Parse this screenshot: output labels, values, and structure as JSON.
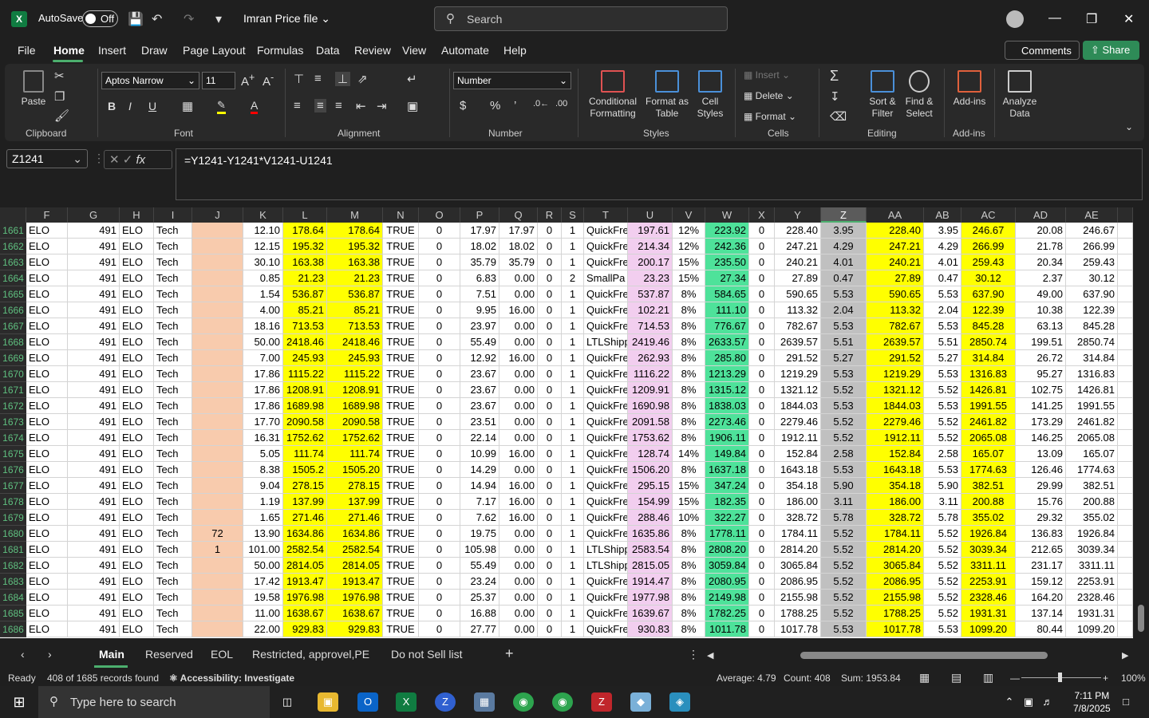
{
  "titlebar": {
    "autosave": "AutoSave",
    "toggle": "Off",
    "filename": "Imran Price file",
    "search_placeholder": "Search"
  },
  "menu": [
    "File",
    "Home",
    "Insert",
    "Draw",
    "Page Layout",
    "Formulas",
    "Data",
    "Review",
    "View",
    "Automate",
    "Help"
  ],
  "buttons": {
    "comments": "Comments",
    "share": "Share"
  },
  "ribbon": {
    "paste": "Paste",
    "clipboard": "Clipboard",
    "font_name": "Aptos Narrow",
    "font_size": "11",
    "font": "Font",
    "alignment": "Alignment",
    "number_format": "Number",
    "number": "Number",
    "conditional": "Conditional Formatting",
    "format_table": "Format as Table",
    "cell_styles": "Cell Styles",
    "styles": "Styles",
    "insert": "Insert",
    "delete": "Delete",
    "format": "Format",
    "cells": "Cells",
    "sort": "Sort & Filter",
    "find": "Find & Select",
    "editing": "Editing",
    "addins": "Add-ins",
    "addins_group": "Add-ins",
    "analyze": "Analyze Data"
  },
  "namebox": "Z1241",
  "formula": "=Y1241-Y1241*V1241-U1241",
  "columns": [
    "F",
    "G",
    "H",
    "I",
    "J",
    "K",
    "L",
    "M",
    "N",
    "O",
    "P",
    "Q",
    "R",
    "S",
    "T",
    "U",
    "V",
    "W",
    "X",
    "Y",
    "Z",
    "AA",
    "AB",
    "AC",
    "AD",
    "AE"
  ],
  "rows": [
    [
      "1661",
      "ELO",
      "491",
      "ELO",
      "Tech",
      "",
      "12.10",
      "178.64",
      "178.64",
      "TRUE",
      "0",
      "17.97",
      "17.97",
      "0",
      "1",
      "QuickFre",
      "197.61",
      "12%",
      "223.92",
      "0",
      "228.40",
      "3.95",
      "228.40",
      "3.95",
      "246.67",
      "20.08",
      "246.67"
    ],
    [
      "1662",
      "ELO",
      "491",
      "ELO",
      "Tech",
      "",
      "12.15",
      "195.32",
      "195.32",
      "TRUE",
      "0",
      "18.02",
      "18.02",
      "0",
      "1",
      "QuickFre",
      "214.34",
      "12%",
      "242.36",
      "0",
      "247.21",
      "4.29",
      "247.21",
      "4.29",
      "266.99",
      "21.78",
      "266.99"
    ],
    [
      "1663",
      "ELO",
      "491",
      "ELO",
      "Tech",
      "",
      "30.10",
      "163.38",
      "163.38",
      "TRUE",
      "0",
      "35.79",
      "35.79",
      "0",
      "1",
      "QuickFre",
      "200.17",
      "15%",
      "235.50",
      "0",
      "240.21",
      "4.01",
      "240.21",
      "4.01",
      "259.43",
      "20.34",
      "259.43"
    ],
    [
      "1664",
      "ELO",
      "491",
      "ELO",
      "Tech",
      "",
      "0.85",
      "21.23",
      "21.23",
      "TRUE",
      "0",
      "6.83",
      "0.00",
      "0",
      "2",
      "SmallPa",
      "23.23",
      "15%",
      "27.34",
      "0",
      "27.89",
      "0.47",
      "27.89",
      "0.47",
      "30.12",
      "2.37",
      "30.12"
    ],
    [
      "1665",
      "ELO",
      "491",
      "ELO",
      "Tech",
      "",
      "1.54",
      "536.87",
      "536.87",
      "TRUE",
      "0",
      "7.51",
      "0.00",
      "0",
      "1",
      "QuickFre",
      "537.87",
      "8%",
      "584.65",
      "0",
      "590.65",
      "5.53",
      "590.65",
      "5.53",
      "637.90",
      "49.00",
      "637.90"
    ],
    [
      "1666",
      "ELO",
      "491",
      "ELO",
      "Tech",
      "",
      "4.00",
      "85.21",
      "85.21",
      "TRUE",
      "0",
      "9.95",
      "16.00",
      "0",
      "1",
      "QuickFre",
      "102.21",
      "8%",
      "111.10",
      "0",
      "113.32",
      "2.04",
      "113.32",
      "2.04",
      "122.39",
      "10.38",
      "122.39"
    ],
    [
      "1667",
      "ELO",
      "491",
      "ELO",
      "Tech",
      "",
      "18.16",
      "713.53",
      "713.53",
      "TRUE",
      "0",
      "23.97",
      "0.00",
      "0",
      "1",
      "QuickFre",
      "714.53",
      "8%",
      "776.67",
      "0",
      "782.67",
      "5.53",
      "782.67",
      "5.53",
      "845.28",
      "63.13",
      "845.28"
    ],
    [
      "1668",
      "ELO",
      "491",
      "ELO",
      "Tech",
      "",
      "50.00",
      "2418.46",
      "2418.46",
      "TRUE",
      "0",
      "55.49",
      "0.00",
      "0",
      "1",
      "LTLShipp",
      "2419.46",
      "8%",
      "2633.57",
      "0",
      "2639.57",
      "5.51",
      "2639.57",
      "5.51",
      "2850.74",
      "199.51",
      "2850.74"
    ],
    [
      "1669",
      "ELO",
      "491",
      "ELO",
      "Tech",
      "",
      "7.00",
      "245.93",
      "245.93",
      "TRUE",
      "0",
      "12.92",
      "16.00",
      "0",
      "1",
      "QuickFre",
      "262.93",
      "8%",
      "285.80",
      "0",
      "291.52",
      "5.27",
      "291.52",
      "5.27",
      "314.84",
      "26.72",
      "314.84"
    ],
    [
      "1670",
      "ELO",
      "491",
      "ELO",
      "Tech",
      "",
      "17.86",
      "1115.22",
      "1115.22",
      "TRUE",
      "0",
      "23.67",
      "0.00",
      "0",
      "1",
      "QuickFre",
      "1116.22",
      "8%",
      "1213.29",
      "0",
      "1219.29",
      "5.53",
      "1219.29",
      "5.53",
      "1316.83",
      "95.27",
      "1316.83"
    ],
    [
      "1671",
      "ELO",
      "491",
      "ELO",
      "Tech",
      "",
      "17.86",
      "1208.91",
      "1208.91",
      "TRUE",
      "0",
      "23.67",
      "0.00",
      "0",
      "1",
      "QuickFre",
      "1209.91",
      "8%",
      "1315.12",
      "0",
      "1321.12",
      "5.52",
      "1321.12",
      "5.52",
      "1426.81",
      "102.75",
      "1426.81"
    ],
    [
      "1672",
      "ELO",
      "491",
      "ELO",
      "Tech",
      "",
      "17.86",
      "1689.98",
      "1689.98",
      "TRUE",
      "0",
      "23.67",
      "0.00",
      "0",
      "1",
      "QuickFre",
      "1690.98",
      "8%",
      "1838.03",
      "0",
      "1844.03",
      "5.53",
      "1844.03",
      "5.53",
      "1991.55",
      "141.25",
      "1991.55"
    ],
    [
      "1673",
      "ELO",
      "491",
      "ELO",
      "Tech",
      "",
      "17.70",
      "2090.58",
      "2090.58",
      "TRUE",
      "0",
      "23.51",
      "0.00",
      "0",
      "1",
      "QuickFre",
      "2091.58",
      "8%",
      "2273.46",
      "0",
      "2279.46",
      "5.52",
      "2279.46",
      "5.52",
      "2461.82",
      "173.29",
      "2461.82"
    ],
    [
      "1674",
      "ELO",
      "491",
      "ELO",
      "Tech",
      "",
      "16.31",
      "1752.62",
      "1752.62",
      "TRUE",
      "0",
      "22.14",
      "0.00",
      "0",
      "1",
      "QuickFre",
      "1753.62",
      "8%",
      "1906.11",
      "0",
      "1912.11",
      "5.52",
      "1912.11",
      "5.52",
      "2065.08",
      "146.25",
      "2065.08"
    ],
    [
      "1675",
      "ELO",
      "491",
      "ELO",
      "Tech",
      "",
      "5.05",
      "111.74",
      "111.74",
      "TRUE",
      "0",
      "10.99",
      "16.00",
      "0",
      "1",
      "QuickFre",
      "128.74",
      "14%",
      "149.84",
      "0",
      "152.84",
      "2.58",
      "152.84",
      "2.58",
      "165.07",
      "13.09",
      "165.07"
    ],
    [
      "1676",
      "ELO",
      "491",
      "ELO",
      "Tech",
      "",
      "8.38",
      "1505.2",
      "1505.20",
      "TRUE",
      "0",
      "14.29",
      "0.00",
      "0",
      "1",
      "QuickFre",
      "1506.20",
      "8%",
      "1637.18",
      "0",
      "1643.18",
      "5.53",
      "1643.18",
      "5.53",
      "1774.63",
      "126.46",
      "1774.63"
    ],
    [
      "1677",
      "ELO",
      "491",
      "ELO",
      "Tech",
      "",
      "9.04",
      "278.15",
      "278.15",
      "TRUE",
      "0",
      "14.94",
      "16.00",
      "0",
      "1",
      "QuickFre",
      "295.15",
      "15%",
      "347.24",
      "0",
      "354.18",
      "5.90",
      "354.18",
      "5.90",
      "382.51",
      "29.99",
      "382.51"
    ],
    [
      "1678",
      "ELO",
      "491",
      "ELO",
      "Tech",
      "",
      "1.19",
      "137.99",
      "137.99",
      "TRUE",
      "0",
      "7.17",
      "16.00",
      "0",
      "1",
      "QuickFre",
      "154.99",
      "15%",
      "182.35",
      "0",
      "186.00",
      "3.11",
      "186.00",
      "3.11",
      "200.88",
      "15.76",
      "200.88"
    ],
    [
      "1679",
      "ELO",
      "491",
      "ELO",
      "Tech",
      "",
      "1.65",
      "271.46",
      "271.46",
      "TRUE",
      "0",
      "7.62",
      "16.00",
      "0",
      "1",
      "QuickFre",
      "288.46",
      "10%",
      "322.27",
      "0",
      "328.72",
      "5.78",
      "328.72",
      "5.78",
      "355.02",
      "29.32",
      "355.02"
    ],
    [
      "1680",
      "ELO",
      "491",
      "ELO",
      "Tech",
      "72",
      "13.90",
      "1634.86",
      "1634.86",
      "TRUE",
      "0",
      "19.75",
      "0.00",
      "0",
      "1",
      "QuickFre",
      "1635.86",
      "8%",
      "1778.11",
      "0",
      "1784.11",
      "5.52",
      "1784.11",
      "5.52",
      "1926.84",
      "136.83",
      "1926.84"
    ],
    [
      "1681",
      "ELO",
      "491",
      "ELO",
      "Tech",
      "1",
      "101.00",
      "2582.54",
      "2582.54",
      "TRUE",
      "0",
      "105.98",
      "0.00",
      "0",
      "1",
      "LTLShipp",
      "2583.54",
      "8%",
      "2808.20",
      "0",
      "2814.20",
      "5.52",
      "2814.20",
      "5.52",
      "3039.34",
      "212.65",
      "3039.34"
    ],
    [
      "1682",
      "ELO",
      "491",
      "ELO",
      "Tech",
      "",
      "50.00",
      "2814.05",
      "2814.05",
      "TRUE",
      "0",
      "55.49",
      "0.00",
      "0",
      "1",
      "LTLShipp",
      "2815.05",
      "8%",
      "3059.84",
      "0",
      "3065.84",
      "5.52",
      "3065.84",
      "5.52",
      "3311.11",
      "231.17",
      "3311.11"
    ],
    [
      "1683",
      "ELO",
      "491",
      "ELO",
      "Tech",
      "",
      "17.42",
      "1913.47",
      "1913.47",
      "TRUE",
      "0",
      "23.24",
      "0.00",
      "0",
      "1",
      "QuickFre",
      "1914.47",
      "8%",
      "2080.95",
      "0",
      "2086.95",
      "5.52",
      "2086.95",
      "5.52",
      "2253.91",
      "159.12",
      "2253.91"
    ],
    [
      "1684",
      "ELO",
      "491",
      "ELO",
      "Tech",
      "",
      "19.58",
      "1976.98",
      "1976.98",
      "TRUE",
      "0",
      "25.37",
      "0.00",
      "0",
      "1",
      "QuickFre",
      "1977.98",
      "8%",
      "2149.98",
      "0",
      "2155.98",
      "5.52",
      "2155.98",
      "5.52",
      "2328.46",
      "164.20",
      "2328.46"
    ],
    [
      "1685",
      "ELO",
      "491",
      "ELO",
      "Tech",
      "",
      "11.00",
      "1638.67",
      "1638.67",
      "TRUE",
      "0",
      "16.88",
      "0.00",
      "0",
      "1",
      "QuickFre",
      "1639.67",
      "8%",
      "1782.25",
      "0",
      "1788.25",
      "5.52",
      "1788.25",
      "5.52",
      "1931.31",
      "137.14",
      "1931.31"
    ],
    [
      "1686",
      "ELO",
      "491",
      "ELO",
      "Tech",
      "",
      "22.00",
      "929.83",
      "929.83",
      "TRUE",
      "0",
      "27.77",
      "0.00",
      "0",
      "1",
      "QuickFre",
      "930.83",
      "8%",
      "1011.78",
      "0",
      "1017.78",
      "5.53",
      "1017.78",
      "5.53",
      "1099.20",
      "80.44",
      "1099.20"
    ]
  ],
  "sheets": [
    "Main",
    "Reserved",
    "EOL",
    "Restricted, approvel,PE",
    "Do not Sell list"
  ],
  "status": {
    "ready": "Ready",
    "records": "408 of 1685 records found",
    "accessibility": "Accessibility: Investigate",
    "average": "Average: 4.79",
    "count": "Count: 408",
    "sum": "Sum: 1953.84",
    "zoom": "100%"
  },
  "taskbar": {
    "search": "Type here to search",
    "time": "7:11 PM",
    "date": "7/8/2025"
  },
  "colors": {
    "yellow": "#ffff00",
    "pink": "#f2ceef",
    "green": "#4ee29a",
    "peach": "#f8cbad",
    "selgray": "#c0c0c0"
  }
}
